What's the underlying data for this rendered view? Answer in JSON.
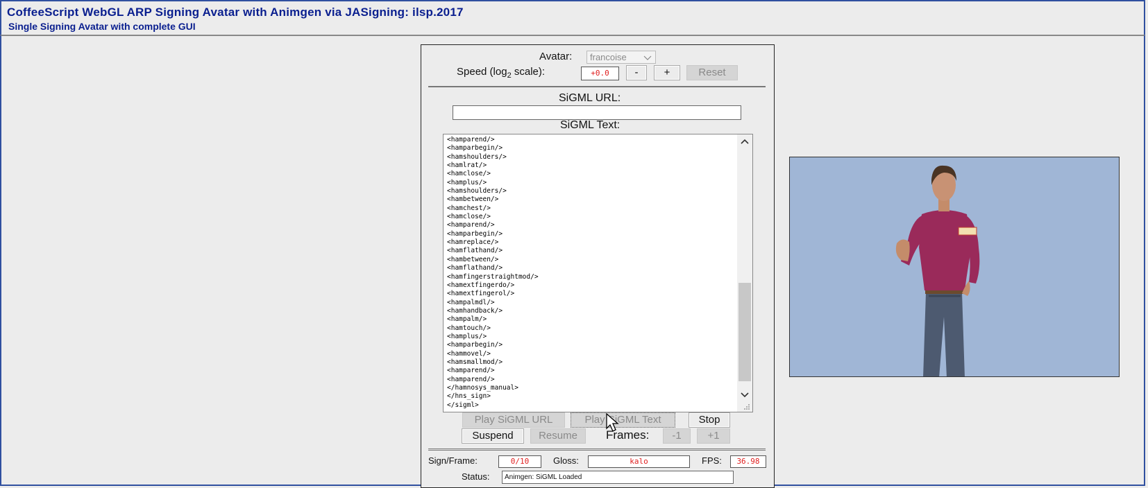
{
  "header": {
    "title": "CoffeeScript WebGL ARP Signing Avatar with Animgen via JASigning: ilsp.2017",
    "subtitle": "Single Signing Avatar with complete GUI"
  },
  "controls": {
    "avatar_label": "Avatar:",
    "avatar_value": "francoise",
    "speed_label_prefix": "Speed (log",
    "speed_label_sub": "2",
    "speed_label_suffix": " scale):",
    "speed_value": "+0.0",
    "minus_label": "-",
    "plus_label": "+",
    "reset_label": "Reset",
    "sigml_url_label": "SiGML URL:",
    "sigml_url_value": "",
    "sigml_text_label": "SiGML Text:",
    "sigml_text_lines": [
      "<hamparend/>",
      "<hamparbegin/>",
      "<hamshoulders/>",
      "<hamlrat/>",
      "<hamclose/>",
      "<hamplus/>",
      "<hamshoulders/>",
      "<hambetween/>",
      "<hamchest/>",
      "<hamclose/>",
      "<hamparend/>",
      "<hamparbegin/>",
      "<hamreplace/>",
      "<hamflathand/>",
      "<hambetween/>",
      "<hamflathand/>",
      "<hamfingerstraightmod/>",
      "<hamextfingerdo/>",
      "<hamextfingerol/>",
      "<hampalmdl/>",
      "<hamhandback/>",
      "<hampalm/>",
      "<hamtouch/>",
      "<hamplus/>",
      "<hamparbegin/>",
      "<hammovel/>",
      "<hamsmallmod/>",
      "<hamparend/>",
      "<hamparend/>",
      "</hamnosys_manual>",
      "</hns_sign>",
      "</sigml>"
    ],
    "play_url_label": "Play SiGML URL",
    "play_text_label": "Play SiGML Text",
    "stop_label": "Stop",
    "suspend_label": "Suspend",
    "resume_label": "Resume",
    "frames_label": "Frames:",
    "frame_minus_label": "-1",
    "frame_plus_label": "+1"
  },
  "status": {
    "sign_frame_label": "Sign/Frame:",
    "sign_frame_value": "0/10",
    "gloss_label": "Gloss:",
    "gloss_value": "kalo",
    "fps_label": "FPS:",
    "fps_value": "36.98",
    "status_label": "Status:",
    "status_value": "Animgen: SiGML Loaded"
  },
  "icons": {
    "scroll_up": "chevron-up-icon",
    "scroll_down": "chevron-down-icon",
    "dropdown": "chevron-down-icon",
    "cursor": "mouse-pointer-icon"
  },
  "colors": {
    "title": "#0a1f8f",
    "value_text": "#e02020",
    "avatar_bg": "#a0b6d6",
    "shirt": "#9a2a5a"
  }
}
